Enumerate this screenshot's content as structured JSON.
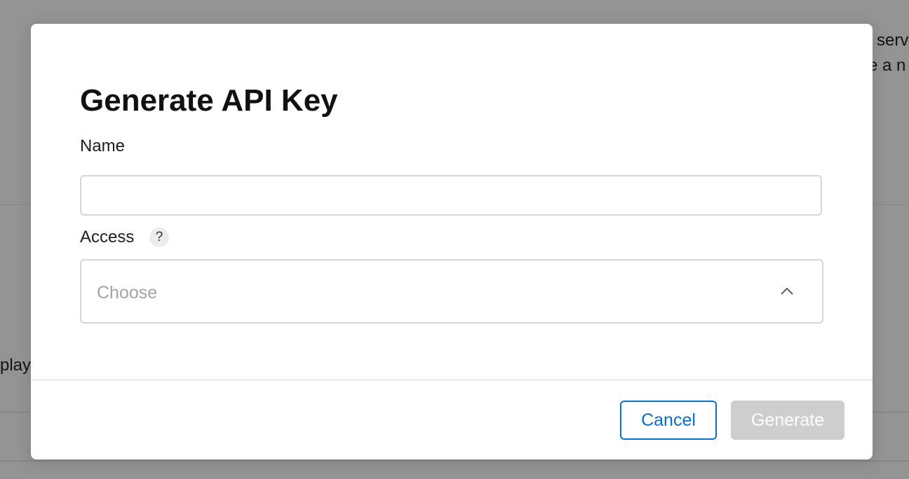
{
  "background": {
    "text_top_right_1": "serv",
    "text_top_right_2": "e a n",
    "text_left": "play"
  },
  "modal": {
    "title": "Generate API Key",
    "name_field": {
      "label": "Name",
      "value": "",
      "placeholder": ""
    },
    "access_field": {
      "label": "Access",
      "help_symbol": "?",
      "placeholder": "Choose",
      "icon": "chevron-up-icon"
    },
    "buttons": {
      "cancel_label": "Cancel",
      "generate_label": "Generate"
    }
  },
  "colors": {
    "accent": "#0a6fc9",
    "disabled_button": "#cecece",
    "overlay": "rgba(0,0,0,0.40)"
  }
}
